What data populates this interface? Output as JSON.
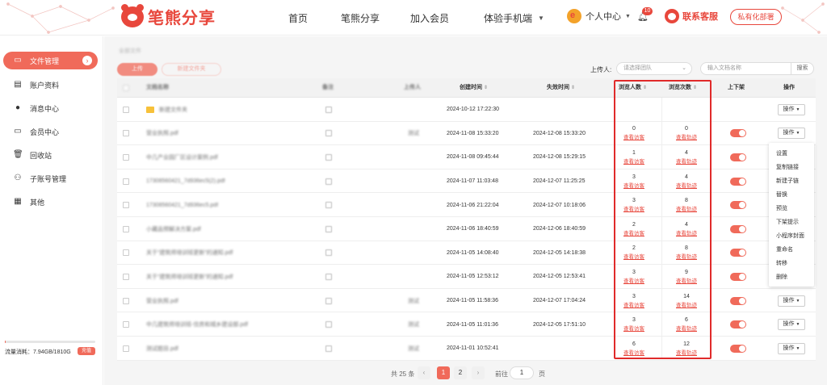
{
  "header": {
    "logo_text": "笔熊分享",
    "nav": [
      "首页",
      "笔熊分享",
      "加入会员",
      "体验手机端"
    ],
    "user_center": "个人中心",
    "notification_count": "10",
    "service": "联系客服",
    "private_deploy": "私有化部署"
  },
  "sidebar": {
    "items": [
      "文件管理",
      "账户资料",
      "消息中心",
      "会员中心",
      "回收站",
      "子账号管理",
      "其他"
    ],
    "storage_text": "流量消耗：7.94GB/1810G",
    "storage_fraction": 0.0044,
    "upgrade": "充值"
  },
  "toolbar": {
    "breadcrumb": "全部文件",
    "upload": "上传",
    "new_folder": "新建文件夹",
    "uploader_label": "上传人:",
    "uploader_placeholder": "请选择团队",
    "search_placeholder": "输入文档名称",
    "search_button": "搜索"
  },
  "table": {
    "headers": {
      "name": "文档名称",
      "remark": "备注",
      "uploader": "上传人",
      "created": "创建时间",
      "expires": "失效时间",
      "viewers": "浏览人数",
      "views": "浏览次数",
      "shelf": "上下架",
      "ops": "操作"
    },
    "viewer_link": "查看访客",
    "views_link": "查看轨迹",
    "op_button": "操作",
    "rows": [
      {
        "name": "新建文件夹",
        "folder": true,
        "uploader": "",
        "created": "2024-10-12 17:22:30",
        "expires": "",
        "viewers": "",
        "views": "",
        "toggle": false,
        "op": true
      },
      {
        "name": "营业执照.pdf",
        "folder": false,
        "uploader": "测试",
        "created": "2024-11-08 15:33:20",
        "expires": "2024-12-08 15:33:20",
        "viewers": "0",
        "views": "0",
        "toggle": true,
        "op": true
      },
      {
        "name": "中几产业园厂区设计案例.pdf",
        "folder": false,
        "uploader": "",
        "created": "2024-11-08 09:45:44",
        "expires": "2024-12-08 15:29:15",
        "viewers": "1",
        "views": "4",
        "toggle": true,
        "op": false
      },
      {
        "name": "17308560421_7d936ec5(2).pdf",
        "folder": false,
        "uploader": "",
        "created": "2024-11-07 11:03:48",
        "expires": "2024-12-07 11:25:25",
        "viewers": "3",
        "views": "4",
        "toggle": true,
        "op": false
      },
      {
        "name": "17308560421_7d936ec5.pdf",
        "folder": false,
        "uploader": "",
        "created": "2024-11-06 21:22:04",
        "expires": "2024-12-07 10:18:06",
        "viewers": "3",
        "views": "8",
        "toggle": true,
        "op": false
      },
      {
        "name": "小藏品预解决方案.pdf",
        "folder": false,
        "uploader": "",
        "created": "2024-11-06 18:40:59",
        "expires": "2024-12-06 18:40:59",
        "viewers": "2",
        "views": "4",
        "toggle": true,
        "op": false
      },
      {
        "name": "关于“建筑师培训班更新”的通知.pdf",
        "folder": false,
        "uploader": "",
        "created": "2024-11-05 14:08:40",
        "expires": "2024-12-05 14:18:38",
        "viewers": "2",
        "views": "8",
        "toggle": true,
        "op": false
      },
      {
        "name": "关于“建筑师培训班更新”的通知.pdf",
        "folder": false,
        "uploader": "",
        "created": "2024-11-05 12:53:12",
        "expires": "2024-12-05 12:53:41",
        "viewers": "3",
        "views": "9",
        "toggle": true,
        "op": false
      },
      {
        "name": "营业执照.pdf",
        "folder": false,
        "uploader": "测试",
        "created": "2024-11-05 11:58:36",
        "expires": "2024-12-07 17:04:24",
        "viewers": "3",
        "views": "14",
        "toggle": true,
        "op": true
      },
      {
        "name": "中几建筑师培训班-住房和城乡建设部.pdf",
        "folder": false,
        "uploader": "测试",
        "created": "2024-11-05 11:01:36",
        "expires": "2024-12-05 17:51:10",
        "viewers": "3",
        "views": "6",
        "toggle": true,
        "op": true
      },
      {
        "name": "测试题目.pdf",
        "folder": false,
        "uploader": "测试",
        "created": "2024-11-01 10:52:41",
        "expires": "",
        "viewers": "6",
        "views": "12",
        "toggle": true,
        "op": true
      }
    ]
  },
  "dropdown": [
    "设置",
    "复制链接",
    "新建子链",
    "替换",
    "预览",
    "下架提示",
    "小程序封面",
    "重命名",
    "转移",
    "删除"
  ],
  "pagination": {
    "total": "共 25 条",
    "pages": [
      "1",
      "2"
    ],
    "prev": "‹",
    "next": "›",
    "goto": "前往",
    "goto_value": "1",
    "page_unit": "页"
  },
  "colors": {
    "brand": "#e8473c",
    "accent": "#f06a5a",
    "highlight_box": "#e02a2a"
  }
}
